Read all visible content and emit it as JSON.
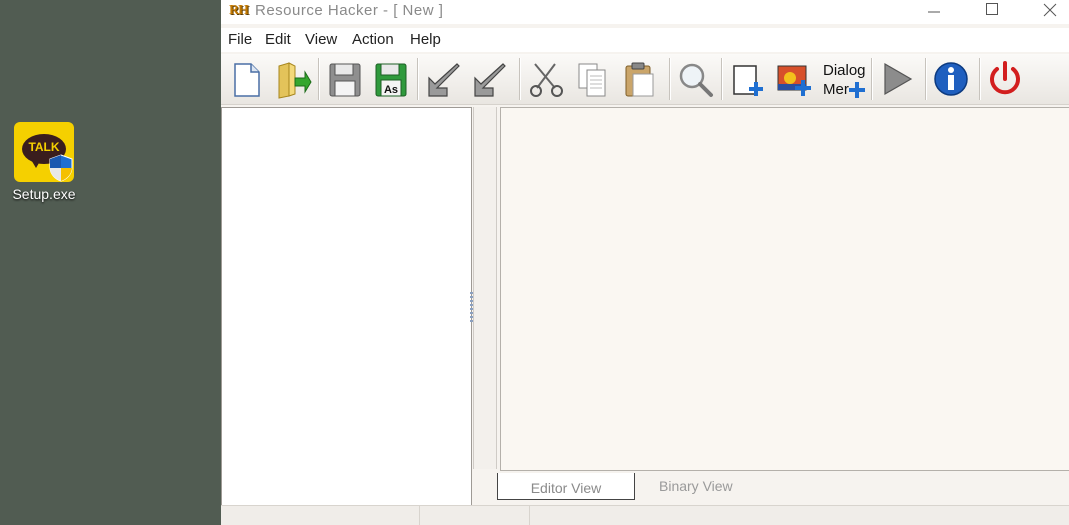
{
  "desktop": {
    "icon_caption": "Setup.exe",
    "icon_text": "TALK",
    "icon_name": "kakaotalk-setup-icon"
  },
  "window": {
    "logo": "RH",
    "title": "Resource Hacker  -  [ New ]",
    "controls": [
      "minimize",
      "maximize",
      "close"
    ]
  },
  "menu": {
    "items": [
      {
        "label": "File"
      },
      {
        "label": "Edit"
      },
      {
        "label": "View"
      },
      {
        "label": "Action"
      },
      {
        "label": "Help"
      }
    ]
  },
  "toolbar": {
    "buttons": [
      {
        "name": "new-file-icon"
      },
      {
        "name": "open-folder-icon"
      },
      {
        "name": "save-icon"
      },
      {
        "name": "save-as-icon",
        "text": "As"
      },
      {
        "name": "arrow-back-icon"
      },
      {
        "name": "arrow-forward-icon"
      },
      {
        "name": "cut-icon"
      },
      {
        "name": "copy-icon"
      },
      {
        "name": "paste-icon"
      },
      {
        "name": "search-icon"
      },
      {
        "name": "add-blank-resource-icon"
      },
      {
        "name": "add-image-resource-icon"
      },
      {
        "name": "dialog-merge-icon",
        "text_top": "Dialog",
        "text_bottom": "Mer"
      },
      {
        "name": "compile-run-icon"
      },
      {
        "name": "info-icon"
      },
      {
        "name": "exit-icon"
      }
    ]
  },
  "tabs": {
    "editor": "Editor View",
    "binary": "Binary View"
  },
  "colors": {
    "desktop": "#515c52",
    "window_bg": "#f6f3ef",
    "accent_blue": "#1f6fd1",
    "exit_red": "#d21e1e",
    "kakao_yellow": "#f5d000"
  }
}
